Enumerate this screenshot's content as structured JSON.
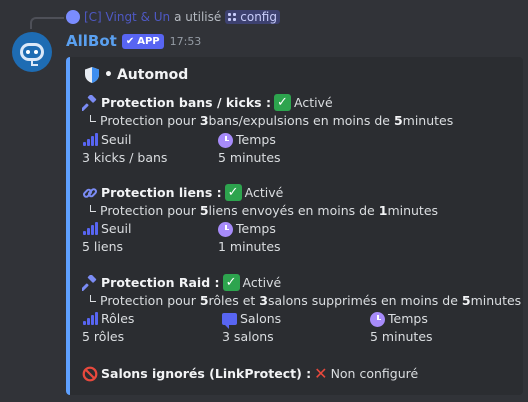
{
  "reply": {
    "user": "[C] Vingt & Un",
    "verb": "a utilisé",
    "command": "config"
  },
  "author": {
    "name": "AllBot",
    "badge": "APP",
    "time": "17:53"
  },
  "embed": {
    "accent": "#5ea0ff",
    "title_sep": "•",
    "title": "Automod",
    "sections": [
      {
        "icon": "hammer-icon",
        "title": "Protection bans / kicks :",
        "status": "Activé",
        "desc_parts": [
          "Protection pour ",
          "3",
          " bans/expulsions en moins de ",
          "5",
          " minutes"
        ],
        "fields": [
          {
            "icon": "signal-bars-icon",
            "name": "Seuil",
            "value": "3 kicks / bans"
          },
          {
            "icon": "clock-icon",
            "name": "Temps",
            "value": "5 minutes"
          }
        ]
      },
      {
        "icon": "link-icon",
        "title": "Protection liens :",
        "status": "Activé",
        "desc_parts": [
          "Protection pour ",
          "5",
          " liens envoyés en moins de ",
          "1",
          " minutes"
        ],
        "fields": [
          {
            "icon": "signal-bars-icon",
            "name": "Seuil",
            "value": "5 liens"
          },
          {
            "icon": "clock-icon",
            "name": "Temps",
            "value": "1 minutes"
          }
        ]
      },
      {
        "icon": "hammer-icon",
        "title": "Protection Raid :",
        "status": "Activé",
        "desc_parts": [
          "Protection pour ",
          "5",
          " rôles et ",
          "3",
          " salons supprimés en moins de ",
          "5",
          " minutes"
        ],
        "fields": [
          {
            "icon": "signal-bars-icon",
            "name": "Rôles",
            "value": "5 rôles"
          },
          {
            "icon": "chat-bubble-icon",
            "name": "Salons",
            "value": "3 salons"
          },
          {
            "icon": "clock-icon",
            "name": "Temps",
            "value": "5 minutes"
          }
        ]
      }
    ],
    "ignored": {
      "icon": "prohibited-icon",
      "title": "Salons ignorés (LinkProtect) :",
      "status": "Non configuré"
    }
  }
}
